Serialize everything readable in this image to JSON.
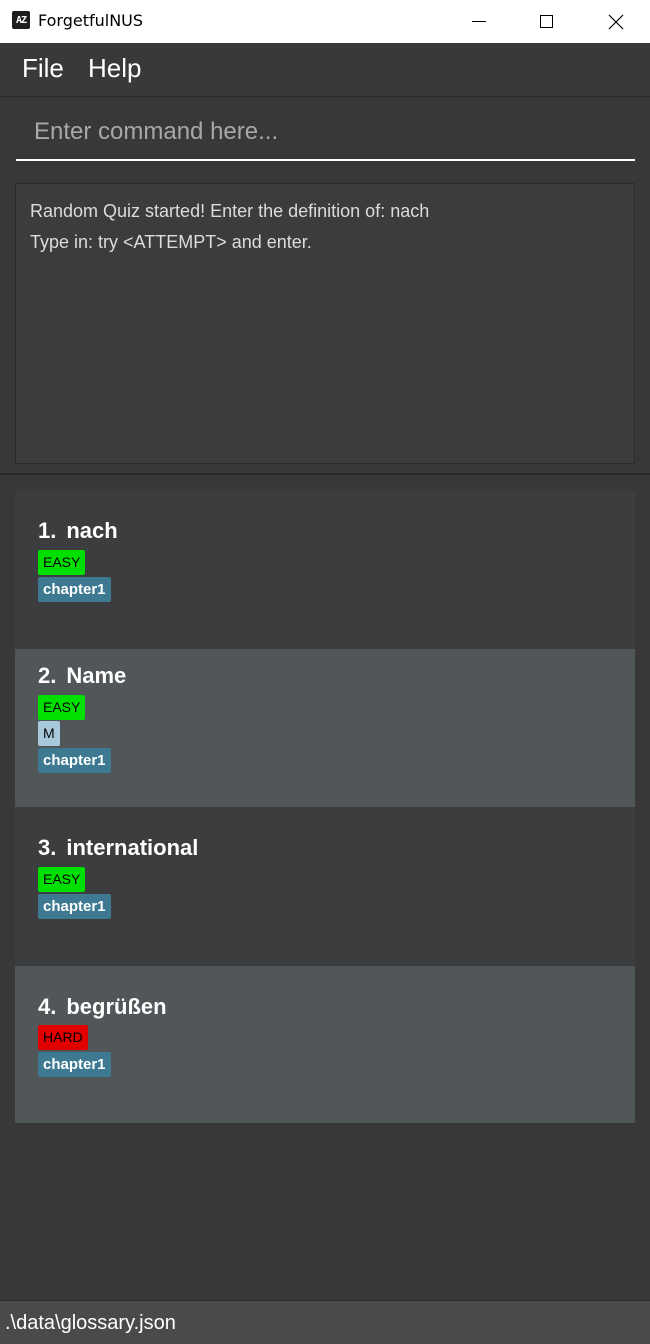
{
  "window": {
    "icon_text": "AZ",
    "title": "ForgetfulNUS"
  },
  "menu": {
    "file": "File",
    "help": "Help"
  },
  "command": {
    "placeholder": "Enter command here...",
    "value": ""
  },
  "result": {
    "lines": [
      "Random Quiz started! Enter the definition of: nach",
      "Type in: try <ATTEMPT> and enter."
    ]
  },
  "cards": [
    {
      "index": "1.",
      "phrase": "nach",
      "difficulty": "EASY",
      "extra_tag": "",
      "tag": "chapter1"
    },
    {
      "index": "2.",
      "phrase": "Name",
      "difficulty": "EASY",
      "extra_tag": "M",
      "tag": "chapter1"
    },
    {
      "index": "3.",
      "phrase": "international",
      "difficulty": "EASY",
      "extra_tag": "",
      "tag": "chapter1"
    },
    {
      "index": "4.",
      "phrase": "begrüßen",
      "difficulty": "HARD",
      "extra_tag": "",
      "tag": "chapter1"
    }
  ],
  "status": {
    "path": ".\\data\\glossary.json"
  },
  "colors": {
    "easy": "#00e000",
    "hard": "#e00000",
    "chapter_tag": "#3d7a91",
    "gender_tag": "#a8c8dc"
  }
}
